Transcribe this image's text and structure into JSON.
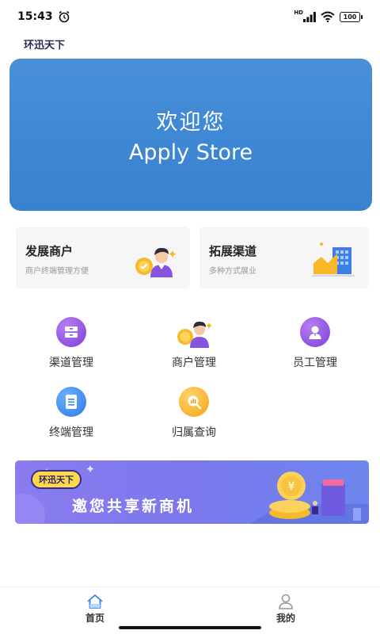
{
  "status_bar": {
    "time": "15:43",
    "network": "HD",
    "battery": "100"
  },
  "header": {
    "title": "环迅天下"
  },
  "banner": {
    "line1": "欢迎您",
    "line2": "Apply Store"
  },
  "cards": [
    {
      "title": "发展商户",
      "subtitle": "商户终端管理方便",
      "icon": "merchant-person-icon"
    },
    {
      "title": "拓展渠道",
      "subtitle": "多种方式展业",
      "icon": "building-chart-icon"
    }
  ],
  "menu": [
    {
      "label": "渠道管理",
      "icon": "folder-icon",
      "color": "#8a4fe0"
    },
    {
      "label": "商户管理",
      "icon": "merchant-person-icon",
      "color": "#f5a623"
    },
    {
      "label": "员工管理",
      "icon": "user-icon",
      "color": "#8a4fe0"
    },
    {
      "label": "终端管理",
      "icon": "document-icon",
      "color": "#3a85ee"
    },
    {
      "label": "归属查询",
      "icon": "search-chart-icon",
      "color": "#f5a623"
    }
  ],
  "promo": {
    "badge": "环迅天下",
    "text": "邀您共享新商机"
  },
  "tabs": [
    {
      "label": "首页",
      "icon": "home-icon",
      "active": true
    },
    {
      "label": "我的",
      "icon": "user-icon",
      "active": false
    }
  ]
}
